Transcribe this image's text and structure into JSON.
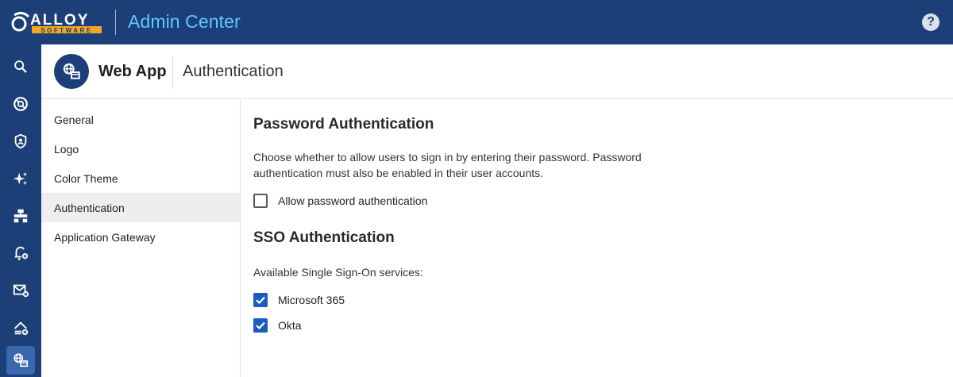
{
  "topbar": {
    "logo_text": "ALLOY",
    "logo_subtext": "SOFTWARE",
    "title": "Admin Center",
    "help_label": "?"
  },
  "rail": {
    "items": [
      {
        "icon": "search-icon"
      },
      {
        "icon": "lifebuoy-icon"
      },
      {
        "icon": "shield-user-icon"
      },
      {
        "icon": "sparkles-icon"
      },
      {
        "icon": "workflow-icon"
      },
      {
        "icon": "bell-gear-icon"
      },
      {
        "icon": "mail-gear-icon"
      },
      {
        "icon": "cloud-gear-icon"
      },
      {
        "icon": "web-app-icon",
        "active": true
      }
    ]
  },
  "header": {
    "app_name": "Web App",
    "page_name": "Authentication",
    "icon": "web-app-icon"
  },
  "subnav": {
    "items": [
      {
        "label": "General"
      },
      {
        "label": "Logo"
      },
      {
        "label": "Color Theme"
      },
      {
        "label": "Authentication",
        "active": true
      },
      {
        "label": "Application Gateway"
      }
    ]
  },
  "password_section": {
    "title": "Password Authentication",
    "description": "Choose whether to allow users to sign in by entering their password. Password authentication must also be enabled in their user accounts.",
    "checkbox_label": "Allow password authentication",
    "checked": false
  },
  "sso_section": {
    "title": "SSO Authentication",
    "services_label": "Available Single Sign-On services:",
    "services": [
      {
        "label": "Microsoft 365",
        "checked": true
      },
      {
        "label": "Okta",
        "checked": true
      }
    ]
  },
  "colors": {
    "brand_navy": "#1d3f77",
    "title_cyan": "#5ec8ff",
    "checkbox_blue": "#1d5bbf",
    "logo_orange": "#f5a623"
  }
}
